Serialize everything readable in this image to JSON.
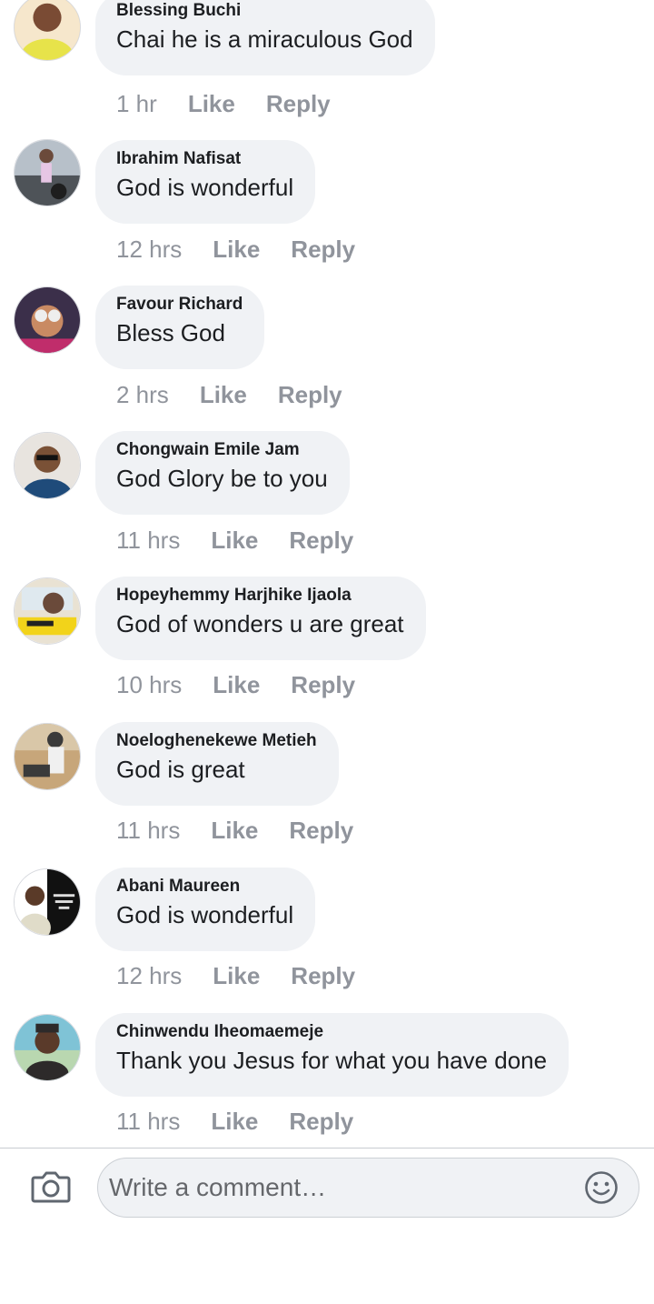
{
  "comments": [
    {
      "author": "Blessing Buchi",
      "text": "Chai he is a miraculous God",
      "time": "1 hr",
      "like": "Like",
      "reply": "Reply",
      "avatar_bg": "#f4d9a0",
      "avatar_fg": "#e7e34a"
    },
    {
      "author": "Ibrahim Nafisat",
      "text": "God is wonderful",
      "time": "12 hrs",
      "like": "Like",
      "reply": "Reply",
      "avatar_bg": "#9aa3ad",
      "avatar_fg": "#2a2a2e"
    },
    {
      "author": "Favour Richard",
      "text": "Bless God",
      "time": "2 hrs",
      "like": "Like",
      "reply": "Reply",
      "avatar_bg": "#3b2f4a",
      "avatar_fg": "#c98a63"
    },
    {
      "author": "Chongwain Emile Jam",
      "text": "God Glory be to you",
      "time": "11 hrs",
      "like": "Like",
      "reply": "Reply",
      "avatar_bg": "#e8e4df",
      "avatar_fg": "#1f4b7a"
    },
    {
      "author": "Hopeyhemmy Harjhike Ijaola",
      "text": "God of wonders u are great",
      "time": "10 hrs",
      "like": "Like",
      "reply": "Reply",
      "avatar_bg": "#e9e2d3",
      "avatar_fg": "#f2d31a"
    },
    {
      "author": "Noeloghenekewe Metieh",
      "text": "God is great",
      "time": "11 hrs",
      "like": "Like",
      "reply": "Reply",
      "avatar_bg": "#c7a67a",
      "avatar_fg": "#3a3a3a"
    },
    {
      "author": "Abani Maureen",
      "text": "God is wonderful",
      "time": "12 hrs",
      "like": "Like",
      "reply": "Reply",
      "avatar_bg": "#ffffff",
      "avatar_fg": "#111111"
    },
    {
      "author": "Chinwendu Iheomaemeje",
      "text": "Thank you Jesus for what you have done",
      "time": "11 hrs",
      "like": "Like",
      "reply": "Reply",
      "avatar_bg": "#7fc3d6",
      "avatar_fg": "#2d2a2a"
    }
  ],
  "composer": {
    "placeholder": "Write a comment…",
    "camera_icon": "camera-icon",
    "emoji_icon": "smiley-icon"
  },
  "colors": {
    "bubble": "#f0f2f5",
    "meta_text": "#90949c",
    "text": "#1c1e21"
  }
}
